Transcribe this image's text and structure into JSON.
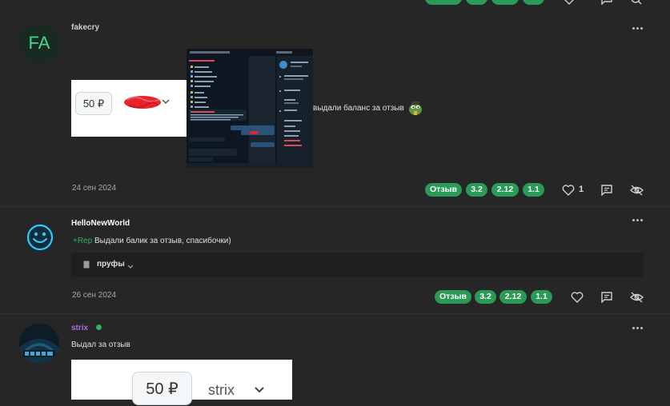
{
  "posts": [
    {
      "username": "fakecry",
      "avatar_initials": "FA",
      "image1": {
        "amount": "50 ₽"
      },
      "image2_caption": "выдали баланс за отзыв",
      "date": "24 сен 2024",
      "tags": [
        "Отзыв",
        "3.2",
        "2.12",
        "1.1"
      ],
      "likes": "1"
    },
    {
      "username": "HelloNewWorld",
      "rep_label": "+Rep",
      "text": "Выдали балик за отзыв, спасибочки)",
      "spoiler_label": "пруфы",
      "date": "26 сен 2024",
      "tags": [
        "Отзыв",
        "3.2",
        "2.12",
        "1.1"
      ]
    },
    {
      "username": "strix",
      "text": "Выдал за отзыв",
      "image": {
        "amount": "50 ₽",
        "name": "strix"
      }
    }
  ],
  "colors": {
    "background": "#262626",
    "tag_green": "#2a9a57",
    "username_purple": "#a86ee0",
    "online_green": "#2fb25e",
    "rep_green": "#2fb25e"
  },
  "icons": [
    "heart-icon",
    "comment-icon",
    "hide-icon",
    "more-icon",
    "chevron-down-icon",
    "document-icon",
    "smiley-avatar-icon"
  ]
}
